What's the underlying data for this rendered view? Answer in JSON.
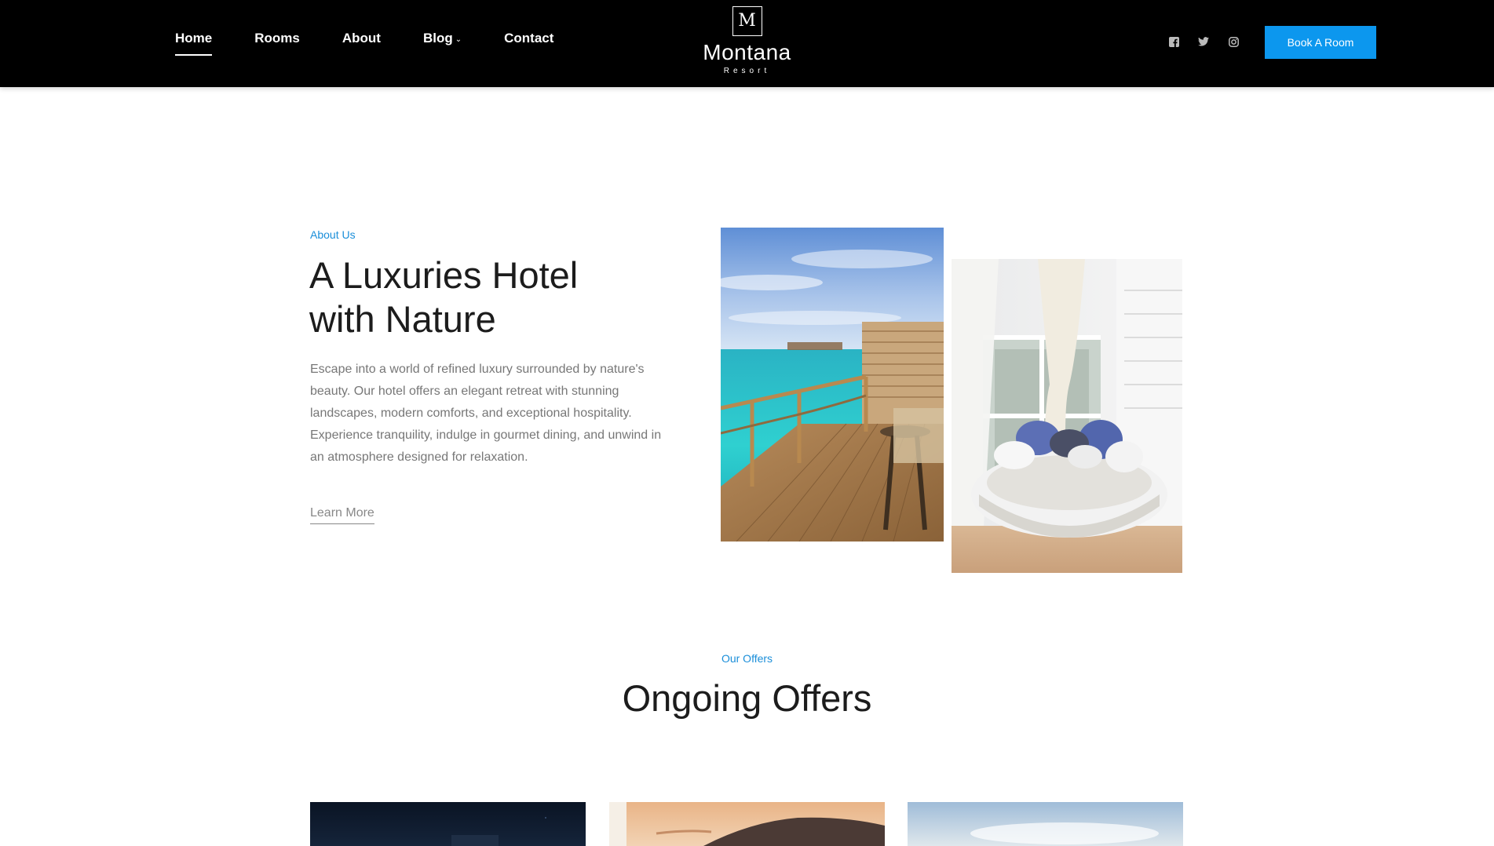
{
  "header": {
    "nav": [
      {
        "label": "Home",
        "active": true
      },
      {
        "label": "Rooms"
      },
      {
        "label": "About"
      },
      {
        "label": "Blog",
        "has_dropdown": true
      },
      {
        "label": "Contact"
      }
    ],
    "logo": {
      "mark": "M",
      "name": "Montana",
      "sub": "Resort"
    },
    "socials": [
      "facebook-icon",
      "twitter-icon",
      "instagram-icon"
    ],
    "book_button": "Book A Room"
  },
  "about": {
    "eyebrow": "About Us",
    "title_line1": "A Luxuries Hotel",
    "title_line2": "with Nature",
    "paragraph": "Escape into a world of refined luxury surrounded by nature's beauty. Our hotel offers an elegant retreat with stunning landscapes, modern comforts, and exceptional hospitality. Experience tranquility, indulge in gourmet dining, and unwind in an atmosphere designed for relaxation.",
    "link": "Learn More"
  },
  "offers": {
    "eyebrow": "Our Offers",
    "title": "Ongoing Offers"
  },
  "colors": {
    "accent": "#0c97ee",
    "header_bg": "#000000",
    "eyebrow": "#1a8ed9"
  }
}
